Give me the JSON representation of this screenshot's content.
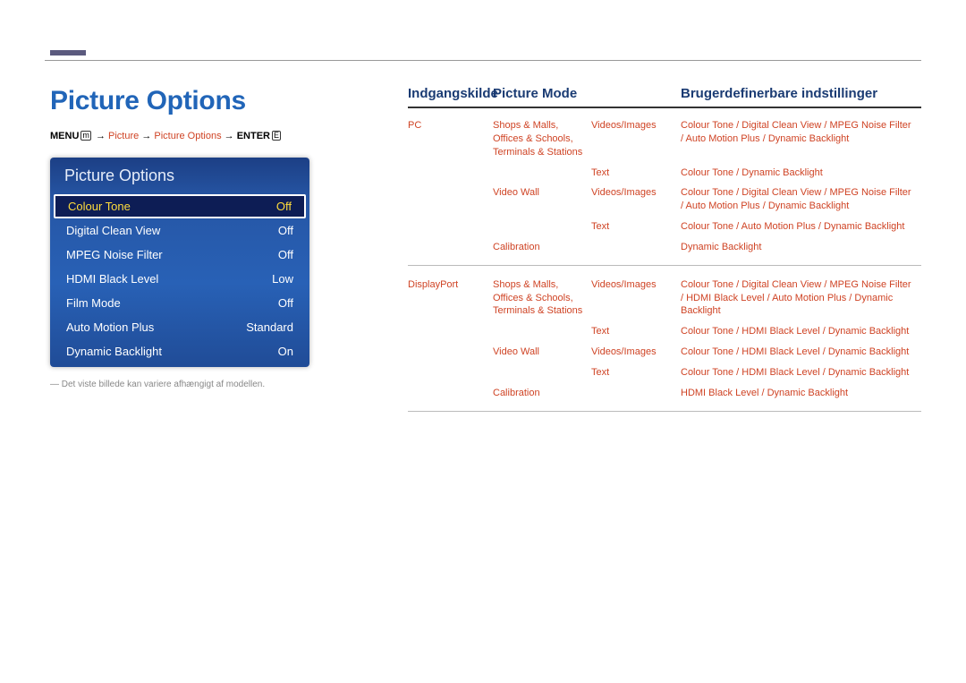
{
  "page_title": "Picture Options",
  "breadcrumb": {
    "menu": "MENU",
    "menu_icon_glyph": "m",
    "arrow": "→",
    "p1": "Picture",
    "p2": "Picture Options",
    "enter": "ENTER",
    "enter_icon_glyph": "E"
  },
  "menu_panel": {
    "header": "Picture Options",
    "rows": [
      {
        "label": "Colour Tone",
        "value": "Off",
        "selected": true
      },
      {
        "label": "Digital Clean View",
        "value": "Off",
        "selected": false
      },
      {
        "label": "MPEG Noise Filter",
        "value": "Off",
        "selected": false
      },
      {
        "label": "HDMI Black Level",
        "value": "Low",
        "selected": false
      },
      {
        "label": "Film Mode",
        "value": "Off",
        "selected": false
      },
      {
        "label": "Auto Motion Plus",
        "value": "Standard",
        "selected": false
      },
      {
        "label": "Dynamic Backlight",
        "value": "On",
        "selected": false
      }
    ]
  },
  "footnote": "― Det viste billede kan variere afhængigt af modellen.",
  "table": {
    "head": {
      "source": "Indgangskilde",
      "mode": "Picture Mode",
      "settings": "Brugerdefinerbare indstillinger"
    },
    "sections": [
      {
        "source": "PC",
        "rows": [
          {
            "mode1": "Shops & Malls, Offices & Schools, Terminals & Stations",
            "mode2": "Videos/Images",
            "settings": "Colour Tone / Digital Clean View / MPEG Noise Filter / Auto Motion Plus / Dynamic Backlight"
          },
          {
            "mode1": "",
            "mode2": "Text",
            "settings": "Colour Tone / Dynamic Backlight"
          },
          {
            "mode1": "Video Wall",
            "mode2": "Videos/Images",
            "settings": "Colour Tone / Digital Clean View / MPEG Noise Filter / Auto Motion Plus / Dynamic Backlight"
          },
          {
            "mode1": "",
            "mode2": "Text",
            "settings": "Colour Tone / Auto Motion Plus / Dynamic Backlight"
          },
          {
            "mode1": "Calibration",
            "mode2": "",
            "settings": "Dynamic Backlight"
          }
        ]
      },
      {
        "source": "DisplayPort",
        "rows": [
          {
            "mode1": "Shops & Malls, Offices & Schools, Terminals & Stations",
            "mode2": "Videos/Images",
            "settings": "Colour Tone / Digital Clean View / MPEG Noise Filter / HDMI Black Level / Auto Motion Plus / Dynamic Backlight"
          },
          {
            "mode1": "",
            "mode2": "Text",
            "settings": "Colour Tone / HDMI Black Level / Dynamic Backlight"
          },
          {
            "mode1": "Video Wall",
            "mode2": "Videos/Images",
            "settings": "Colour Tone / HDMI Black Level / Dynamic Backlight"
          },
          {
            "mode1": "",
            "mode2": "Text",
            "settings": "Colour Tone / HDMI Black Level / Dynamic Backlight"
          },
          {
            "mode1": "Calibration",
            "mode2": "",
            "settings": "HDMI Black Level / Dynamic Backlight"
          }
        ]
      }
    ]
  }
}
